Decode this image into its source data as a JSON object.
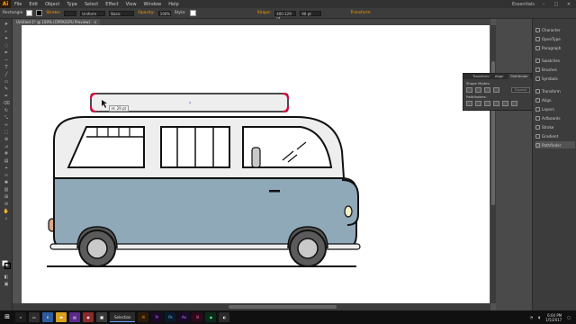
{
  "app": {
    "logo": "Ai",
    "menus": [
      "File",
      "Edit",
      "Object",
      "Type",
      "Select",
      "Effect",
      "View",
      "Window",
      "Help"
    ],
    "workspace": "Essentials"
  },
  "control": {
    "object_type": "Rectangle",
    "stroke_label": "Stroke:",
    "stroke_profile": "Uniform",
    "brush": "Basic",
    "opacity_label": "Opacity:",
    "opacity_value": "100%",
    "style_label": "Style:",
    "shape_label": "Shape:",
    "width_value": "400.129 pt",
    "height_value": "90 pt",
    "transform_label": "Transform"
  },
  "document": {
    "tab_title": "Untitled-1* @ 100% (CMYK/GPU Preview)",
    "close": "×"
  },
  "canvas": {
    "tooltip": "H: 29 pt"
  },
  "status": {
    "selection": "Selection"
  },
  "pathfinder": {
    "tabs": [
      "Transform",
      "Align",
      "Pathfinder"
    ],
    "shape_modes_label": "Shape Modes:",
    "pathfinders_label": "Pathfinders:",
    "expand_label": "Expand"
  },
  "dock": {
    "items": [
      "Character",
      "OpenType",
      "Paragraph",
      "Swatches",
      "Brushes",
      "Symbols",
      "Transform",
      "Align",
      "Layers",
      "Artboards",
      "Stroke",
      "Gradient",
      "Pathfinder"
    ]
  },
  "taskbar": {
    "active_app": "Selection",
    "time": "6:04 PM",
    "date": "1/5/2017"
  },
  "colors": {
    "van_body": "#8fa9b8",
    "van_top": "#eeeeee",
    "lamp": "#f5f0c8",
    "taillight": "#d9a78a",
    "selection": "#e0003a"
  }
}
